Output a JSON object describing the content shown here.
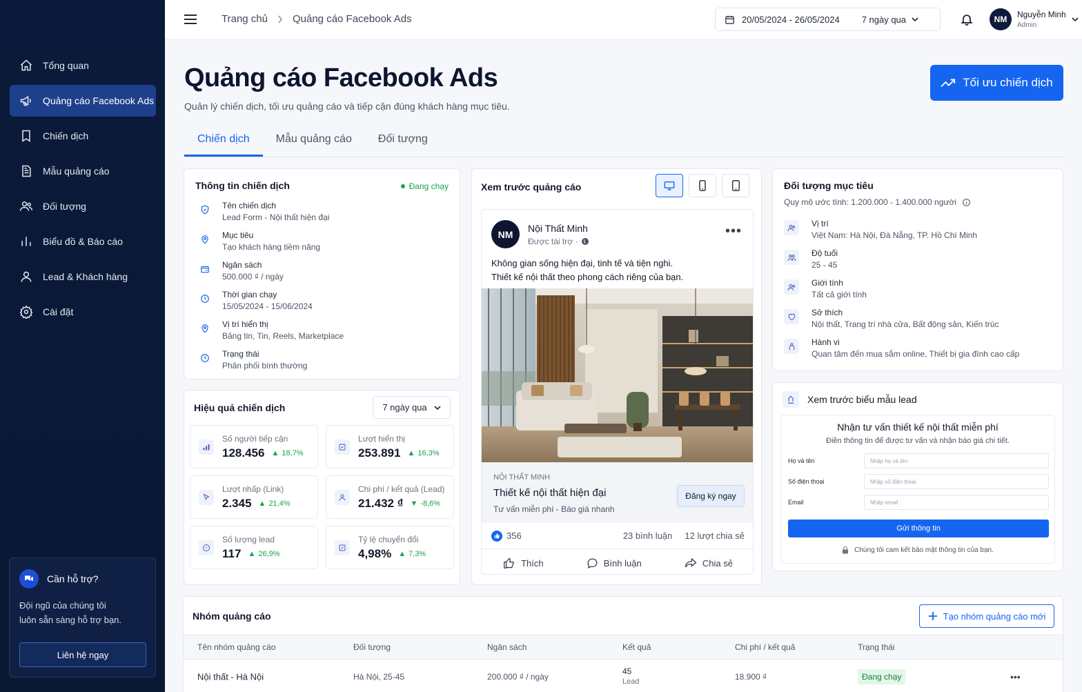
{
  "sidebar": {
    "items": [
      {
        "label": "Tổng quan",
        "icon": "home-icon"
      },
      {
        "label": "Quảng cáo Facebook Ads",
        "icon": "megaphone-icon",
        "active": true
      },
      {
        "label": "Chiến dịch",
        "icon": "bookmark-icon"
      },
      {
        "label": "Mẫu quảng cáo",
        "icon": "document-icon"
      },
      {
        "label": "Đối tượng",
        "icon": "users-icon"
      },
      {
        "label": "Biểu đồ & Báo cáo",
        "icon": "bar-chart-icon"
      },
      {
        "label": "Lead & Khách hàng",
        "icon": "user-icon"
      },
      {
        "label": "Cài đặt",
        "icon": "gear-icon"
      }
    ],
    "help": {
      "title": "Cần hỗ trợ?",
      "line1": "Đội ngũ của chúng tôi",
      "line2": "luôn sẵn sàng hỗ trợ bạn.",
      "button": "Liên hệ ngay"
    }
  },
  "topbar": {
    "breadcrumb_home": "Trang chủ",
    "breadcrumb_current": "Quảng cáo Facebook Ads",
    "date_range": "20/05/2024 - 26/05/2024",
    "date_preset": "7 ngày qua",
    "user_name": "Nguyễn Minh",
    "user_role": "Admin",
    "user_initials": "NM"
  },
  "header": {
    "title": "Quảng cáo Facebook Ads",
    "subtitle": "Quản lý chiến dịch, tối ưu quảng cáo và tiếp cận đúng khách hàng mục tiêu.",
    "cta": "Tối ưu chiến dịch"
  },
  "tabs": [
    "Chiến dịch",
    "Mẫu quảng cáo",
    "Đối tượng"
  ],
  "campaign_info": {
    "title": "Thông tin chiến dịch",
    "status": "Đang chạy",
    "rows": [
      {
        "label": "Tên chiến dịch",
        "value": "Lead Form - Nội thất hiện đại"
      },
      {
        "label": "Mục tiêu",
        "value": "Tạo khách hàng tiềm năng"
      },
      {
        "label": "Ngân sách",
        "value": "500.000 ₫ / ngày"
      },
      {
        "label": "Thời gian chạy",
        "value": "15/05/2024 - 15/06/2024"
      },
      {
        "label": "Vị trí hiển thị",
        "value": "Bảng tin, Tin, Reels, Marketplace"
      },
      {
        "label": "Trạng thái",
        "value": "Phân phối bình thường"
      }
    ]
  },
  "performance": {
    "title": "Hiệu quả chiến dịch",
    "period": "7 ngày qua",
    "metrics": [
      {
        "label": "Số người tiếp cận",
        "value": "128.456",
        "delta": "18,7%",
        "dir": "up"
      },
      {
        "label": "Lượt hiển thị",
        "value": "253.891",
        "delta": "16,3%",
        "dir": "up"
      },
      {
        "label": "Lượt nhấp (Link)",
        "value": "2.345",
        "delta": "21,4%",
        "dir": "up"
      },
      {
        "label": "Chi phí / kết quả (Lead)",
        "value": "21.432 ₫",
        "delta": "-8,6%",
        "dir": "down"
      },
      {
        "label": "Số lượng lead",
        "value": "117",
        "delta": "26,9%",
        "dir": "up"
      },
      {
        "label": "Tỷ lệ chuyển đổi",
        "value": "4,98%",
        "delta": "7,3%",
        "dir": "up"
      }
    ]
  },
  "ad_preview": {
    "title": "Xem trước quảng cáo",
    "page_name": "Nội Thất Minh",
    "page_initials": "NM",
    "sponsored": "Được tài trợ ·",
    "text_line1": "Không gian sống hiện đại, tinh tế và tiện nghi.",
    "text_line2": "Thiết kế nội thất theo phong cách riêng của bạn.",
    "brand": "NỘI THẤT MINH",
    "headline": "Thiết kế nội thất hiện đại",
    "description": "Tư vấn miễn phí - Báo giá nhanh",
    "cta": "Đăng ký ngay",
    "likes": "356",
    "comments": "23 bình luận",
    "shares": "12 lượt chia sẻ",
    "action_like": "Thích",
    "action_comment": "Bình luận",
    "action_share": "Chia sẻ"
  },
  "audience": {
    "title": "Đối tượng mục tiêu",
    "estimate": "Quy mô ước tính: 1.200.000 - 1.400.000 người",
    "rows": [
      {
        "label": "Vị trí",
        "value": "Việt Nam: Hà Nội, Đà Nẵng, TP. Hồ Chí Minh"
      },
      {
        "label": "Độ tuổi",
        "value": "25 - 45"
      },
      {
        "label": "Giới tính",
        "value": "Tất cả giới tính"
      },
      {
        "label": "Sở thích",
        "value": "Nội thất, Trang trí nhà cửa, Bất động sản, Kiến trúc"
      },
      {
        "label": "Hành vi",
        "value": "Quan tâm đến mua sắm online, Thiết bị gia đình cao cấp"
      }
    ]
  },
  "lead_form": {
    "title": "Xem trước biểu mẫu lead",
    "form_title": "Nhận tư vấn thiết kế nội thất miễn phí",
    "form_sub": "Điền thông tin để được tư vấn và nhận báo giá chi tiết.",
    "fields": [
      {
        "label": "Họ và tên",
        "placeholder": "Nhập họ và tên"
      },
      {
        "label": "Số điện thoại",
        "placeholder": "Nhập số điện thoại"
      },
      {
        "label": "Email",
        "placeholder": "Nhập email"
      }
    ],
    "submit": "Gửi thông tin",
    "note": "Chúng tôi cam kết bảo mật thông tin của bạn."
  },
  "ad_groups": {
    "title": "Nhóm quảng cáo",
    "new_button": "Tạo nhóm quảng cáo mới",
    "columns": [
      "Tên nhóm quảng cáo",
      "Đối tượng",
      "Ngân sách",
      "Kết quả",
      "Chi phí / kết quả",
      "Trạng thái"
    ],
    "rows": [
      {
        "name": "Nội thất - Hà Nội",
        "audience": "Hà Nội, 25-45",
        "budget": "200.000 ₫ / ngày",
        "result": "45",
        "result_unit": "Lead",
        "cpr": "18.900 ₫",
        "status": "Đang chạy"
      }
    ]
  },
  "colors": {
    "primary": "#1565f0",
    "sidebar": "#0b1a3a",
    "success": "#16a34a"
  }
}
